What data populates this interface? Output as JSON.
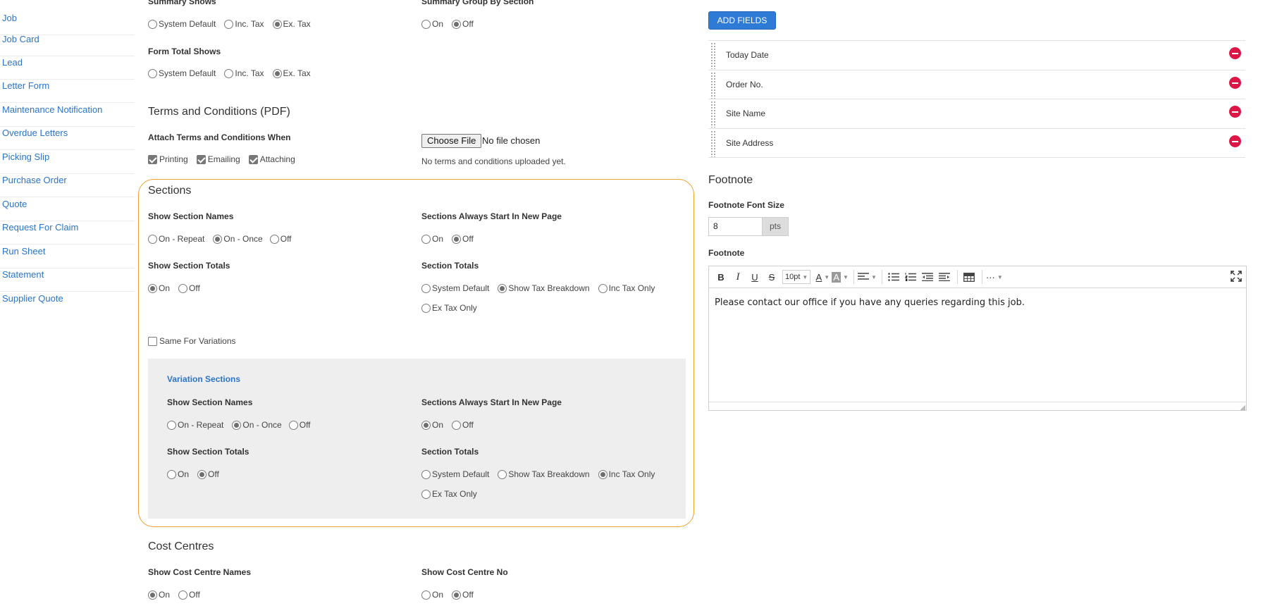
{
  "sidebar": {
    "items": [
      "Job",
      "Job Card",
      "Lead",
      "Letter Form",
      "Maintenance Notification",
      "Overdue Letters",
      "Picking Slip",
      "Purchase Order",
      "Quote",
      "Request For Claim",
      "Run Sheet",
      "Statement",
      "Supplier Quote"
    ]
  },
  "summary": {
    "summary_shows_label": "Summary Shows",
    "summary_shows_options": [
      "System Default",
      "Inc. Tax",
      "Ex. Tax"
    ],
    "group_by_section_label": "Summary Group By Section",
    "group_by_section_options": [
      "On",
      "Off"
    ],
    "form_total_label": "Form Total Shows",
    "form_total_options": [
      "System Default",
      "Inc. Tax",
      "Ex. Tax"
    ]
  },
  "terms": {
    "heading": "Terms and Conditions (PDF)",
    "attach_label": "Attach Terms and Conditions When",
    "attach_options": [
      "Printing",
      "Emailing",
      "Attaching"
    ],
    "choose_file_label": "Choose File",
    "no_file_text": "No file chosen",
    "status": "No terms and conditions uploaded yet."
  },
  "sections": {
    "heading": "Sections",
    "show_names_label": "Show Section Names",
    "show_names_options": [
      "On - Repeat",
      "On - Once",
      "Off"
    ],
    "new_page_label": "Sections Always Start In New Page",
    "new_page_options": [
      "On",
      "Off"
    ],
    "show_totals_label": "Show Section Totals",
    "show_totals_options": [
      "On",
      "Off"
    ],
    "totals_label": "Section Totals",
    "totals_options": [
      "System Default",
      "Show Tax Breakdown",
      "Inc Tax Only",
      "Ex Tax Only"
    ],
    "same_for_variations": "Same For Variations",
    "variation": {
      "title": "Variation Sections",
      "show_names_label": "Show Section Names",
      "show_names_options": [
        "On - Repeat",
        "On - Once",
        "Off"
      ],
      "new_page_label": "Sections Always Start In New Page",
      "new_page_options": [
        "On",
        "Off"
      ],
      "show_totals_label": "Show Section Totals",
      "show_totals_options": [
        "On",
        "Off"
      ],
      "totals_label": "Section Totals",
      "totals_options": [
        "System Default",
        "Show Tax Breakdown",
        "Inc Tax Only",
        "Ex Tax Only"
      ]
    }
  },
  "cost_centres": {
    "heading": "Cost Centres",
    "show_names_label": "Show Cost Centre Names",
    "show_names_options": [
      "On",
      "Off"
    ],
    "show_no_label": "Show Cost Centre No",
    "show_no_options": [
      "On",
      "Off"
    ]
  },
  "fields": {
    "add_button": "ADD FIELDS",
    "items": [
      "Today Date",
      "Order No.",
      "Site Name",
      "Site Address"
    ]
  },
  "footnote": {
    "heading": "Footnote",
    "font_size_label": "Footnote Font Size",
    "font_size_value": "8",
    "font_size_unit": "pts",
    "label": "Footnote",
    "toolbar": {
      "bold": "B",
      "italic": "I",
      "underline": "U",
      "strike": "S",
      "font_size": "10pt",
      "font_color": "A",
      "bg_color": "A",
      "more": "···",
      "fullscreen": "⛶"
    },
    "text": "Please contact our office if you have any queries regarding this job."
  },
  "colors": {
    "link": "#2a74c9",
    "accent": "#2e7bd6",
    "highlight_border": "#f0a030",
    "remove": "#dd1745"
  }
}
